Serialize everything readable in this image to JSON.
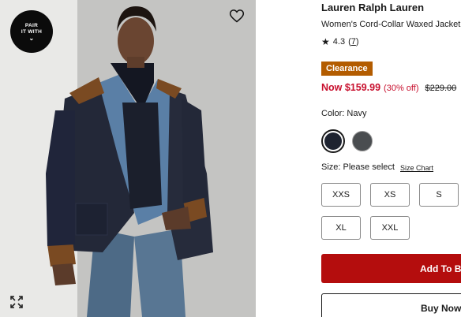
{
  "product_image": {
    "pair_badge": {
      "line1": "PAIR",
      "line2": "IT WITH",
      "chevron": "⌄"
    },
    "favorite_icon": "heart-icon",
    "expand_icon": "expand-icon"
  },
  "product": {
    "brand": "Lauren Ralph Lauren",
    "name": "Women's Cord-Collar Waxed Jacket",
    "rating_star": "★",
    "rating": "4.3",
    "review_count": "7",
    "badge": "Clearance",
    "price_now": "Now $159.99",
    "discount": "(30% off)",
    "price_was": "$229.00"
  },
  "color": {
    "label": "Color: Navy",
    "swatches": [
      {
        "name": "Navy",
        "hex": "#1e2330",
        "selected": true
      },
      {
        "name": "Charcoal",
        "hex": "#4a4d50",
        "selected": false
      }
    ]
  },
  "size": {
    "label": "Size: Please select",
    "chart_link": "Size Chart",
    "options": [
      "XXS",
      "XS",
      "S",
      "XL",
      "XXL"
    ]
  },
  "actions": {
    "add_to_bag": "Add To Bag",
    "buy_now": "Buy Now"
  },
  "colors": {
    "clearance": "#b35c00",
    "sale_red": "#c8102e",
    "add_button": "#b40d0d"
  }
}
